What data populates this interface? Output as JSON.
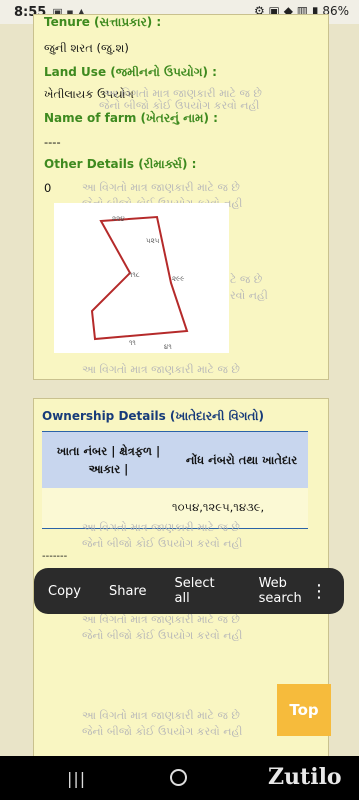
{
  "status_bar": {
    "time": "8:55",
    "indicators": "▣ ▪ ▲",
    "battery_text": "86%",
    "right_icons": "⚙ ▣ ◆ ▥ ▮"
  },
  "details": {
    "tenure_label": "Tenure (સત્તાપ્રકાર) :",
    "tenure_value": "જુની શરત (જુ.શ)",
    "land_use_label": "Land Use (જમીનનો ઉપયોગ) :",
    "land_use_value": "ખેતીલાયક ઉપયોગ",
    "farm_name_label": "Name of farm (ખેતરનું નામ) :",
    "farm_name_value": "----",
    "other_details_label": "Other Details (રીમાર્ક્સ) :",
    "other_details_value": "0"
  },
  "watermark": {
    "line1": "આ વિગતો માત્ર જાણકારી માટે જ છે",
    "line2": "જેનો બીજો કોઈ ઉપયોગ કરવો નહી",
    "line1_short": "ટે જ છે",
    "line2_short": "રવો નહી"
  },
  "sketch": {
    "labels": [
      "૨૨૪",
      "૫૨૫",
      "૧૧૮",
      "૨૯૯",
      "૧૧",
      "૪૧"
    ]
  },
  "ownership": {
    "title": "Ownership Details (ખાતેદારની વિગતો)",
    "col1": "ખાતા નંબર | ક્ષેત્રફળ | આકાર |",
    "col2": "નોંધ નંબરો તથા ખાતેદાર",
    "row1_value": "૧૦૫૪,૧૨૯૫,૧૪૩૯,",
    "dashes": "-------"
  },
  "selection_menu": {
    "copy": "Copy",
    "share": "Share",
    "select_all": "Select all",
    "web_search": "Web search"
  },
  "top_button": "Top",
  "brand_logo": "Zutilo"
}
